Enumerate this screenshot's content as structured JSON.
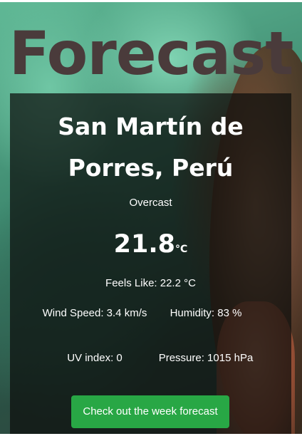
{
  "header": {
    "title": "Forecast"
  },
  "weather": {
    "city_line1": "San Martín de",
    "city_line2": "Porres, Perú",
    "condition": "Overcast",
    "temperature": "21.8",
    "temperature_unit": "°C",
    "feels_like": "Feels Like: 22.2 °C",
    "wind_speed": "Wind Speed: 3.4 km/s",
    "humidity": "Humidity: 83 %",
    "uv_index": "UV index: 0",
    "pressure": "Pressure: 1015 hPa"
  },
  "actions": {
    "week_forecast_label": "Check out the week forecast"
  },
  "colors": {
    "title": "#4a3b3b",
    "button": "#28a745",
    "card_background": "rgba(12,14,12,0.72)"
  }
}
